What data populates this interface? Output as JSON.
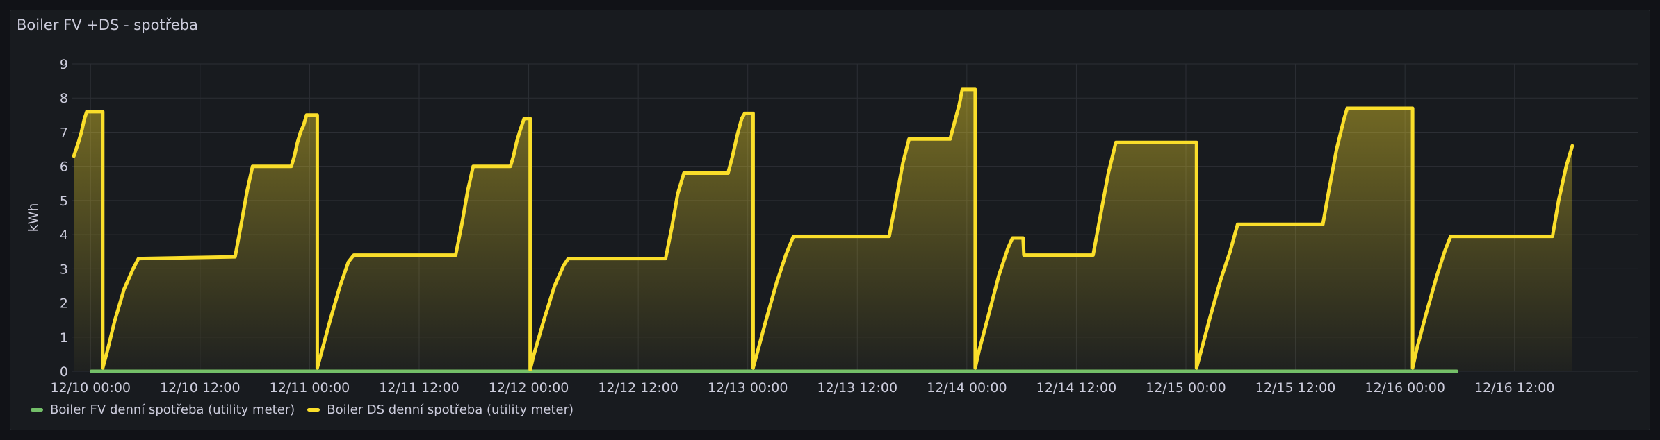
{
  "panel": {
    "title": "Boiler FV +DS - spotřeba"
  },
  "colors": {
    "fv": "#73bf69",
    "ds": "#fade2a",
    "grid": "#2c2f35",
    "text": "#ccccdc"
  },
  "chart_data": {
    "type": "line",
    "title": "Boiler FV +DS - spotřeba",
    "xlabel": "",
    "ylabel": "kWh",
    "ylim": [
      0,
      9
    ],
    "yticks": [
      0,
      1,
      2,
      3,
      4,
      5,
      6,
      7,
      8,
      9
    ],
    "xlim": [
      "2024-12-09 22:00",
      "2024-12-17 01:30"
    ],
    "xticks": [
      {
        "x": "2024-12-10 00:00",
        "label": "12/10 00:00"
      },
      {
        "x": "2024-12-10 12:00",
        "label": "12/10 12:00"
      },
      {
        "x": "2024-12-11 00:00",
        "label": "12/11 00:00"
      },
      {
        "x": "2024-12-11 12:00",
        "label": "12/11 12:00"
      },
      {
        "x": "2024-12-12 00:00",
        "label": "12/12 00:00"
      },
      {
        "x": "2024-12-12 12:00",
        "label": "12/12 12:00"
      },
      {
        "x": "2024-12-13 00:00",
        "label": "12/13 00:00"
      },
      {
        "x": "2024-12-13 12:00",
        "label": "12/13 12:00"
      },
      {
        "x": "2024-12-14 00:00",
        "label": "12/14 00:00"
      },
      {
        "x": "2024-12-14 12:00",
        "label": "12/14 12:00"
      },
      {
        "x": "2024-12-15 00:00",
        "label": "12/15 00:00"
      },
      {
        "x": "2024-12-15 12:00",
        "label": "12/15 12:00"
      },
      {
        "x": "2024-12-16 00:00",
        "label": "12/16 00:00"
      },
      {
        "x": "2024-12-16 12:00",
        "label": "12/16 12:00"
      }
    ],
    "grid": true,
    "legend": "bottom-left",
    "series": [
      {
        "name": "Boiler FV denní spotřeba (utility meter)",
        "color": "#73bf69",
        "points": [
          [
            "2024-12-10 00:05",
            0
          ],
          [
            "2024-12-16 05:40",
            0
          ]
        ]
      },
      {
        "name": "Boiler DS denní spotřeba (utility meter)",
        "color": "#fade2a",
        "fill": true,
        "points": [
          [
            "2024-12-09 22:10",
            6.3
          ],
          [
            "2024-12-09 22:40",
            6.7
          ],
          [
            "2024-12-09 23:00",
            7.0
          ],
          [
            "2024-12-09 23:20",
            7.4
          ],
          [
            "2024-12-09 23:35",
            7.6
          ],
          [
            "2024-12-10 01:20",
            7.6
          ],
          [
            "2024-12-10 01:20",
            0.1
          ],
          [
            "2024-12-10 01:45",
            0.5
          ],
          [
            "2024-12-10 02:40",
            1.5
          ],
          [
            "2024-12-10 03:40",
            2.4
          ],
          [
            "2024-12-10 04:40",
            3.0
          ],
          [
            "2024-12-10 05:15",
            3.3
          ],
          [
            "2024-12-10 15:50",
            3.35
          ],
          [
            "2024-12-10 16:30",
            4.3
          ],
          [
            "2024-12-10 17:10",
            5.3
          ],
          [
            "2024-12-10 17:45",
            6.0
          ],
          [
            "2024-12-10 22:00",
            6.0
          ],
          [
            "2024-12-10 22:20",
            6.3
          ],
          [
            "2024-12-10 22:40",
            6.7
          ],
          [
            "2024-12-10 23:00",
            7.0
          ],
          [
            "2024-12-10 23:20",
            7.2
          ],
          [
            "2024-12-10 23:40",
            7.5
          ],
          [
            "2024-12-11 00:50",
            7.5
          ],
          [
            "2024-12-11 00:50",
            0.1
          ],
          [
            "2024-12-11 01:15",
            0.5
          ],
          [
            "2024-12-11 02:15",
            1.5
          ],
          [
            "2024-12-11 03:20",
            2.5
          ],
          [
            "2024-12-11 04:15",
            3.2
          ],
          [
            "2024-12-11 04:50",
            3.4
          ],
          [
            "2024-12-11 16:00",
            3.4
          ],
          [
            "2024-12-11 16:40",
            4.3
          ],
          [
            "2024-12-11 17:20",
            5.3
          ],
          [
            "2024-12-11 17:55",
            6.0
          ],
          [
            "2024-12-11 22:00",
            6.0
          ],
          [
            "2024-12-11 22:20",
            6.3
          ],
          [
            "2024-12-11 22:40",
            6.7
          ],
          [
            "2024-12-11 23:00",
            7.0
          ],
          [
            "2024-12-11 23:30",
            7.4
          ],
          [
            "2024-12-12 00:10",
            7.4
          ],
          [
            "2024-12-12 00:10",
            0.05
          ],
          [
            "2024-12-12 00:35",
            0.5
          ],
          [
            "2024-12-12 01:40",
            1.5
          ],
          [
            "2024-12-12 02:50",
            2.5
          ],
          [
            "2024-12-12 03:50",
            3.1
          ],
          [
            "2024-12-12 04:20",
            3.3
          ],
          [
            "2024-12-12 15:00",
            3.3
          ],
          [
            "2024-12-12 15:40",
            4.2
          ],
          [
            "2024-12-12 16:20",
            5.2
          ],
          [
            "2024-12-12 17:00",
            5.8
          ],
          [
            "2024-12-12 21:50",
            5.8
          ],
          [
            "2024-12-12 22:20",
            6.3
          ],
          [
            "2024-12-12 22:50",
            6.9
          ],
          [
            "2024-12-12 23:20",
            7.4
          ],
          [
            "2024-12-12 23:40",
            7.55
          ],
          [
            "2024-12-13 00:35",
            7.55
          ],
          [
            "2024-12-13 00:35",
            0.1
          ],
          [
            "2024-12-13 01:00",
            0.5
          ],
          [
            "2024-12-13 02:00",
            1.5
          ],
          [
            "2024-12-13 03:10",
            2.6
          ],
          [
            "2024-12-13 04:10",
            3.4
          ],
          [
            "2024-12-13 05:00",
            3.95
          ],
          [
            "2024-12-13 15:30",
            3.95
          ],
          [
            "2024-12-13 16:10",
            4.9
          ],
          [
            "2024-12-13 17:00",
            6.1
          ],
          [
            "2024-12-13 17:40",
            6.8
          ],
          [
            "2024-12-13 22:10",
            6.8
          ],
          [
            "2024-12-13 22:40",
            7.3
          ],
          [
            "2024-12-13 23:10",
            7.8
          ],
          [
            "2024-12-13 23:30",
            8.25
          ],
          [
            "2024-12-14 00:55",
            8.25
          ],
          [
            "2024-12-14 00:55",
            0.1
          ],
          [
            "2024-12-14 01:20",
            0.6
          ],
          [
            "2024-12-14 02:20",
            1.6
          ],
          [
            "2024-12-14 03:30",
            2.8
          ],
          [
            "2024-12-14 04:30",
            3.6
          ],
          [
            "2024-12-14 05:00",
            3.9
          ],
          [
            "2024-12-14 06:10",
            3.9
          ],
          [
            "2024-12-14 06:15",
            3.4
          ],
          [
            "2024-12-14 13:50",
            3.4
          ],
          [
            "2024-12-14 14:40",
            4.6
          ],
          [
            "2024-12-14 15:30",
            5.8
          ],
          [
            "2024-12-14 16:20",
            6.7
          ],
          [
            "2024-12-15 01:10",
            6.7
          ],
          [
            "2024-12-15 01:10",
            0.1
          ],
          [
            "2024-12-15 01:40",
            0.6
          ],
          [
            "2024-12-15 02:40",
            1.6
          ],
          [
            "2024-12-15 03:50",
            2.7
          ],
          [
            "2024-12-15 04:50",
            3.5
          ],
          [
            "2024-12-15 05:40",
            4.3
          ],
          [
            "2024-12-15 15:00",
            4.3
          ],
          [
            "2024-12-15 15:40",
            5.3
          ],
          [
            "2024-12-15 16:30",
            6.5
          ],
          [
            "2024-12-15 17:20",
            7.4
          ],
          [
            "2024-12-15 17:40",
            7.7
          ],
          [
            "2024-12-16 00:50",
            7.7
          ],
          [
            "2024-12-16 00:50",
            0.1
          ],
          [
            "2024-12-16 01:20",
            0.7
          ],
          [
            "2024-12-16 02:20",
            1.7
          ],
          [
            "2024-12-16 03:30",
            2.8
          ],
          [
            "2024-12-16 04:20",
            3.5
          ],
          [
            "2024-12-16 05:00",
            3.95
          ],
          [
            "2024-12-16 16:10",
            3.95
          ],
          [
            "2024-12-16 16:50",
            5.0
          ],
          [
            "2024-12-16 17:40",
            6.0
          ],
          [
            "2024-12-16 18:20",
            6.6
          ]
        ]
      }
    ]
  }
}
